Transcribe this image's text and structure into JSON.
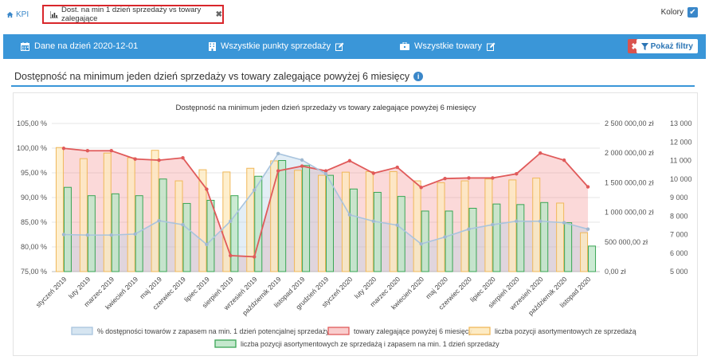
{
  "nav": {
    "kpi_label": "KPI"
  },
  "tab": {
    "label": "Dost. na min 1 dzień sprzedaży vs towary zalegające"
  },
  "kolory": {
    "label": "Kolory",
    "checked": true
  },
  "filters": {
    "date_label": "Dane na dzień 2020-12-01",
    "stores_label": "Wszystkie punkty sprzedaży",
    "products_label": "Wszystkie towary",
    "show_filters_label": "Pokaż filtry"
  },
  "section": {
    "title": "Dostępność na minimum jeden dzień sprzedaży vs towary zalegające powyżej 6 miesięcy"
  },
  "colors": {
    "accent": "#3a96d8",
    "tab_border": "#d9262b",
    "clear": "#d9534f"
  },
  "chart_data": {
    "type": "bar",
    "title": "Dostępność na minimum jeden dzień sprzedaży vs towary zalegające powyżej 6 miesięcy",
    "categories": [
      "styczeń 2019",
      "luty 2019",
      "marzec 2019",
      "kwiecień 2019",
      "maj 2019",
      "czerwiec 2019",
      "lipiec 2019",
      "sierpień 2019",
      "wrzesień 2019",
      "październik 2019",
      "listopad 2019",
      "grudzień 2019",
      "styczeń 2020",
      "luty 2020",
      "marzec 2020",
      "kwiecień 2020",
      "maj 2020",
      "czerwiec 2020",
      "lipiec 2020",
      "sierpień 2020",
      "wrzesień 2020",
      "październik 2020",
      "listopad 2020"
    ],
    "axes": {
      "y_left": {
        "min": 75,
        "max": 105,
        "ticks": [
          "75,00 %",
          "80,00 %",
          "85,00 %",
          "90,00 %",
          "95,00 %",
          "100,00 %",
          "105,00 %"
        ]
      },
      "y_mid": {
        "min": 0,
        "max": 2500000,
        "ticks": [
          "0,00 zł",
          "500 000,00 zł",
          "1 000 000,00 zł",
          "1 500 000,00 zł",
          "2 000 000,00 zł",
          "2 500 000,00 zł"
        ]
      },
      "y_right": {
        "min": 5000,
        "max": 13000,
        "ticks": [
          "5 000",
          "6 000",
          "7 000",
          "8 000",
          "9 000",
          "10 000",
          "11 000",
          "12 000",
          "13 000"
        ]
      }
    },
    "grid": true,
    "legend_position": "bottom",
    "series": [
      {
        "name": "% dostępności towarów z zapasem na min. 1 dzień potencjalnej sprzedaży",
        "axis": "y_left",
        "type": "area",
        "color": "#a9c4de",
        "values": [
          82.5,
          82.4,
          82.4,
          82.6,
          85.3,
          84.5,
          80.5,
          85.2,
          91.5,
          98.9,
          97.6,
          94.8,
          86.5,
          85.2,
          84.4,
          80.6,
          82.0,
          83.6,
          84.5,
          85.2,
          85.2,
          84.9,
          83.6
        ]
      },
      {
        "name": "towary zalegające powyżej 6 miesięcy",
        "axis": "y_mid",
        "type": "area",
        "color": "#e05a5a",
        "values": [
          2080000,
          2040000,
          2040000,
          1900000,
          1880000,
          1920000,
          1390000,
          270000,
          250000,
          1700000,
          1780000,
          1700000,
          1870000,
          1660000,
          1760000,
          1420000,
          1570000,
          1580000,
          1580000,
          1650000,
          2000000,
          1880000,
          1430000
        ]
      },
      {
        "name": "liczba pozycji asortymentowych ze sprzedażą",
        "axis": "y_right",
        "type": "bar",
        "color": "#f0b85a",
        "values": [
          11700,
          11100,
          11400,
          11150,
          11550,
          9900,
          10500,
          10380,
          10580,
          10980,
          10470,
          10200,
          10370,
          10400,
          10400,
          9900,
          9800,
          9900,
          10000,
          9950,
          10050,
          8700,
          7100
        ]
      },
      {
        "name": "liczba pozycji asortymentowych ze sprzedażą i zapasem na min. 1 dzień sprzedaży",
        "axis": "y_right",
        "type": "bar",
        "color": "#3aa655",
        "values": [
          9550,
          9100,
          9200,
          9100,
          10000,
          8680,
          8850,
          9100,
          10150,
          11000,
          10730,
          10200,
          9460,
          9280,
          9060,
          8270,
          8270,
          8420,
          8650,
          8620,
          8730,
          7640,
          6380
        ]
      }
    ]
  }
}
